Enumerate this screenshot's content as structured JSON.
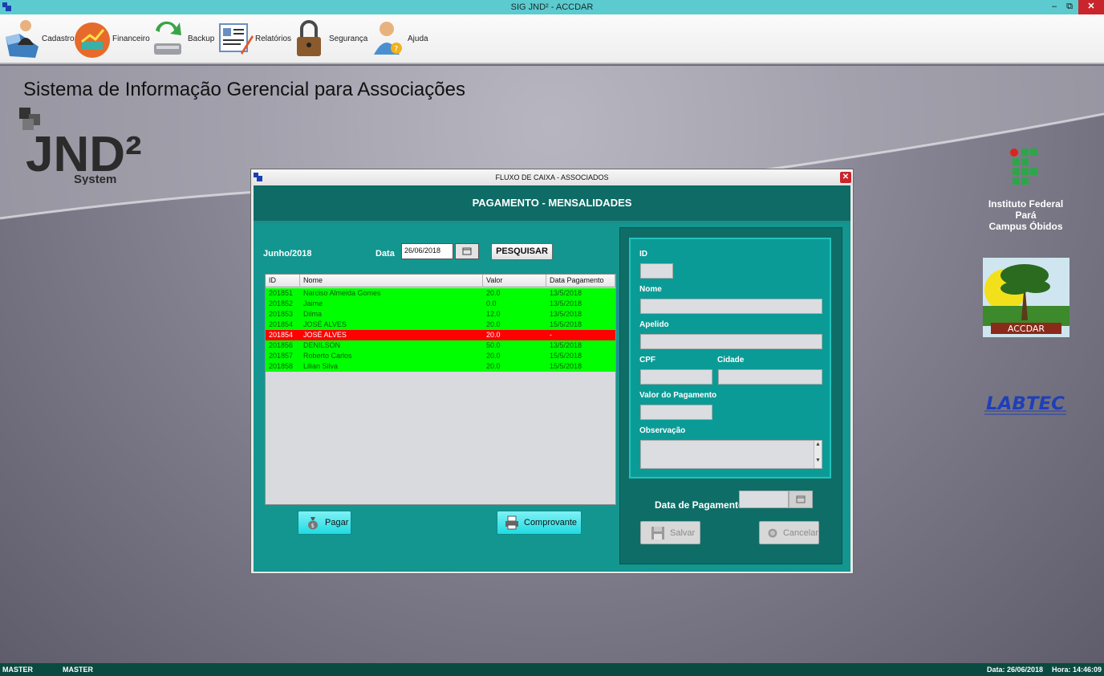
{
  "window": {
    "title": "SIG JND² - ACCDAR",
    "min": "–",
    "max": "⧉",
    "close": "✕"
  },
  "menu": {
    "items": [
      {
        "label": "Cadastro",
        "icon": "user-folder-icon"
      },
      {
        "label": "Financeiro",
        "icon": "finance-chart-icon"
      },
      {
        "label": "Backup",
        "icon": "backup-icon"
      },
      {
        "label": "Relatórios",
        "icon": "report-icon"
      },
      {
        "label": "Segurança",
        "icon": "padlock-icon"
      },
      {
        "label": "Ajuda",
        "icon": "help-user-icon"
      }
    ]
  },
  "desktop": {
    "title": "Sistema de Informação Gerencial para Associações",
    "logo_text": "JND²",
    "logo_sub": "System",
    "institution": [
      "Instituto Federal",
      "Pará",
      "Campus Óbidos"
    ],
    "accdar_label": "ACCDAR",
    "labtec_label": "LABTEC"
  },
  "dialog": {
    "title": "FLUXO DE CAIXA - ASSOCIADOS",
    "close": "✕",
    "header": "PAGAMENTO - MENSALIDADES",
    "month_label": "Junho/2018",
    "date_label": "Data",
    "date_value": "26/06/2018",
    "search_label": "PESQUISAR",
    "table": {
      "columns": [
        "ID",
        "Nome",
        "Valor",
        "Data Pagamento"
      ],
      "rows": [
        {
          "id": "201851",
          "nome": "Narciso Almeida Gomes",
          "valor": "20.0",
          "data": "13/5/2018",
          "status": "paid"
        },
        {
          "id": "201852",
          "nome": "Jaime",
          "valor": "0.0",
          "data": "13/5/2018",
          "status": "paid"
        },
        {
          "id": "201853",
          "nome": "Dilma",
          "valor": "12.0",
          "data": "13/5/2018",
          "status": "paid"
        },
        {
          "id": "201854",
          "nome": "JOSÉ ALVES",
          "valor": "20.0",
          "data": "15/5/2018",
          "status": "paid"
        },
        {
          "id": "201854",
          "nome": "JOSÉ ALVES",
          "valor": "20.0",
          "data": "-",
          "status": "unpaid"
        },
        {
          "id": "201856",
          "nome": "DENILSON",
          "valor": "50.0",
          "data": "13/5/2018",
          "status": "paid"
        },
        {
          "id": "201857",
          "nome": "Roberto Carlos",
          "valor": "20.0",
          "data": "15/5/2018",
          "status": "paid"
        },
        {
          "id": "201858",
          "nome": "Lilian Silva",
          "valor": "20.0",
          "data": "15/5/2018",
          "status": "paid"
        }
      ]
    },
    "pay_button": "Pagar",
    "receipt_button": "Comprovante",
    "form": {
      "id_label": "ID",
      "nome_label": "Nome",
      "apelido_label": "Apelido",
      "cpf_label": "CPF",
      "cidade_label": "Cidade",
      "valor_label": "Valor do Pagamento",
      "obs_label": "Observação",
      "data_pag_label": "Data de Pagamento",
      "save_button": "Salvar",
      "cancel_button": "Cancelar"
    }
  },
  "status": {
    "user1": "MASTER",
    "user2": "MASTER",
    "date": "Data: 26/06/2018",
    "time": "Hora: 14:46:09"
  },
  "colors": {
    "paid_row": "#00ff00",
    "unpaid_row": "#ff0000",
    "dialog_teal": "#13968f",
    "titlebar": "#5ccbcf"
  }
}
